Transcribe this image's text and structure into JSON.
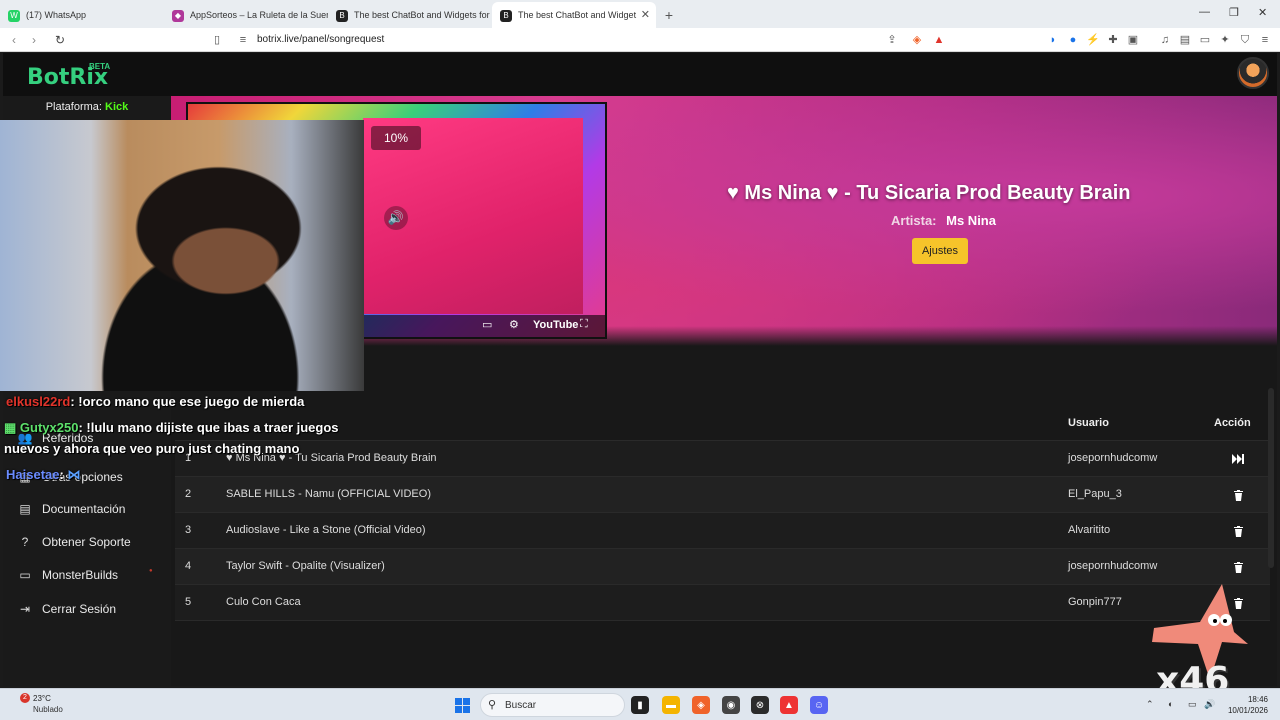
{
  "browser": {
    "tabs": [
      {
        "label": "(17) WhatsApp",
        "icon": "whatsapp-icon",
        "color": "#25d366",
        "active": false
      },
      {
        "label": "AppSorteos – La Ruleta de la Suerte",
        "icon": "appsorteos-icon",
        "color": "#b0389a",
        "active": false
      },
      {
        "label": "The best ChatBot and Widgets for Ki",
        "icon": "botrix-icon",
        "color": "#222222",
        "active": false
      },
      {
        "label": "The best ChatBot and Widget",
        "icon": "botrix-icon",
        "color": "#222222",
        "active": true
      }
    ],
    "new_tab": "+",
    "url": "botrix.live/panel/songrequest"
  },
  "app": {
    "logo": "BotRix",
    "beta": "BETA",
    "platform_label": "Plataforma:",
    "platform_value": "Kick"
  },
  "sidebar": {
    "items": [
      {
        "label": "Referidos",
        "icon": "users-icon"
      },
      {
        "label": "Otras opciones",
        "icon": "grid-icon"
      },
      {
        "label": "Documentación",
        "icon": "document-icon"
      },
      {
        "label": "Obtener Soporte",
        "icon": "help-icon"
      },
      {
        "label": "MonsterBuilds",
        "icon": "laptop-icon"
      },
      {
        "label": "Cerrar Sesión",
        "icon": "logout-icon"
      }
    ]
  },
  "now_playing": {
    "title": "♥ Ms Nina ♥ - Tu Sicaria Prod Beauty Brain",
    "artist_label": "Artista:",
    "artist": "Ms Nina",
    "settings_button": "Ajustes",
    "volume": "10%",
    "player_brand": "YouTube"
  },
  "queue": {
    "headers": {
      "user": "Usuario",
      "action": "Acción"
    },
    "rows": [
      {
        "num": "1",
        "title": "♥ Ms Nina ♥ - Tu Sicaria Prod Beauty Brain",
        "user": "josepornhudcomw",
        "action": "skip-icon"
      },
      {
        "num": "2",
        "title": "SABLE HILLS - Namu (OFFICIAL VIDEO)",
        "user": "El_Papu_3",
        "action": "trash-icon"
      },
      {
        "num": "3",
        "title": "Audioslave - Like a Stone (Official Video)",
        "user": "Alvaritito",
        "action": "trash-icon"
      },
      {
        "num": "4",
        "title": "Taylor Swift - Opalite (Visualizer)",
        "user": "josepornhudcomw",
        "action": "trash-icon"
      },
      {
        "num": "5",
        "title": "Culo Con Caca",
        "user": "Gonpin777",
        "action": "trash-icon"
      }
    ]
  },
  "chat": [
    {
      "name": "elkusl22rd",
      "text": ": !orco mano que ese juego de mierda",
      "color": "#e0342b"
    },
    {
      "name": "Gutyx250",
      "text": ": !lulu mano dijiste que ibas a traer juegos",
      "color": "#5de06b"
    },
    {
      "name": "",
      "text": "nuevos y ahora que veo puro just chating mano",
      "color": "#ffffff"
    },
    {
      "name": "Haisetae",
      "text": ":",
      "color": "#6a8bff"
    }
  ],
  "overlay": {
    "combo": "x46"
  },
  "taskbar": {
    "weather_temp": "23°C",
    "weather_cond": "Nublado",
    "weather_badge": "2",
    "search_placeholder": "Buscar",
    "time": "18:46",
    "date": "10/01/2026"
  }
}
